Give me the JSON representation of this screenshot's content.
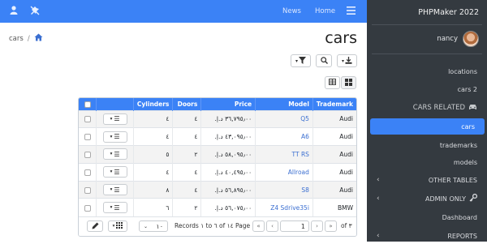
{
  "topbar": {
    "nav_items": [
      "News",
      "Home"
    ],
    "icons": [
      "user-icon",
      "notification-off-icon",
      "menu-icon"
    ]
  },
  "breadcrumb": {
    "parent": "cars",
    "separator": "/"
  },
  "page": {
    "title": "cars"
  },
  "grid": {
    "headers": [
      "Cylinders",
      "Doors",
      "Price",
      "Model",
      "Trademark"
    ],
    "rows": [
      {
        "cylinders": "٤",
        "doors": "٤",
        "price": "٣٦,٧٩٥٫٠٠ د.إ.‏",
        "model": "Q5",
        "trademark": "Audi"
      },
      {
        "cylinders": "٤",
        "doors": "٤",
        "price": "٤٣,٠٩٥٫٠٠ د.إ.‏",
        "model": "A6",
        "trademark": "Audi"
      },
      {
        "cylinders": "٥",
        "doors": "٢",
        "price": "٥٨,٠٩٥٫٠٠ د.إ.‏",
        "model": "TT RS",
        "trademark": "Audi"
      },
      {
        "cylinders": "٤",
        "doors": "٤",
        "price": "٤٠,٤٩٥٫٠٠ د.إ.‏",
        "model": "Allroad",
        "trademark": "Audi"
      },
      {
        "cylinders": "٨",
        "doors": "٤",
        "price": "٥٦,٨٩٥٫٠٠ د.إ.‏",
        "model": "S8",
        "trademark": "Audi"
      },
      {
        "cylinders": "٦",
        "doors": "٢",
        "price": "٥٦,٠٧٥٫٠٠ د.إ.‏",
        "model": "Z4 Sdrive35i",
        "trademark": "BMW"
      }
    ],
    "pager": {
      "page_size": "١٠",
      "records_text": "Records ١ to ٦ of ١٤",
      "page_label": "Page",
      "page_value": "1",
      "of_text": "of ٣"
    }
  },
  "sidebar": {
    "brand": "PHPMaker 2022",
    "user": "nancy",
    "items": [
      {
        "label": "locations"
      },
      {
        "label": "cars 2"
      },
      {
        "label": "CARS RELATED",
        "header": true
      },
      {
        "label": "cars",
        "active": true
      },
      {
        "label": "trademarks"
      },
      {
        "label": "models"
      },
      {
        "label": "OTHER TABLES",
        "group": true
      },
      {
        "label": "ADMIN ONLY",
        "group": true
      },
      {
        "label": "Dashboard"
      },
      {
        "label": "REPORTS",
        "group": true
      }
    ]
  },
  "colors": {
    "accent": "#3b82f6",
    "sidebar_bg": "#343a40",
    "link": "#3b6fd1"
  }
}
